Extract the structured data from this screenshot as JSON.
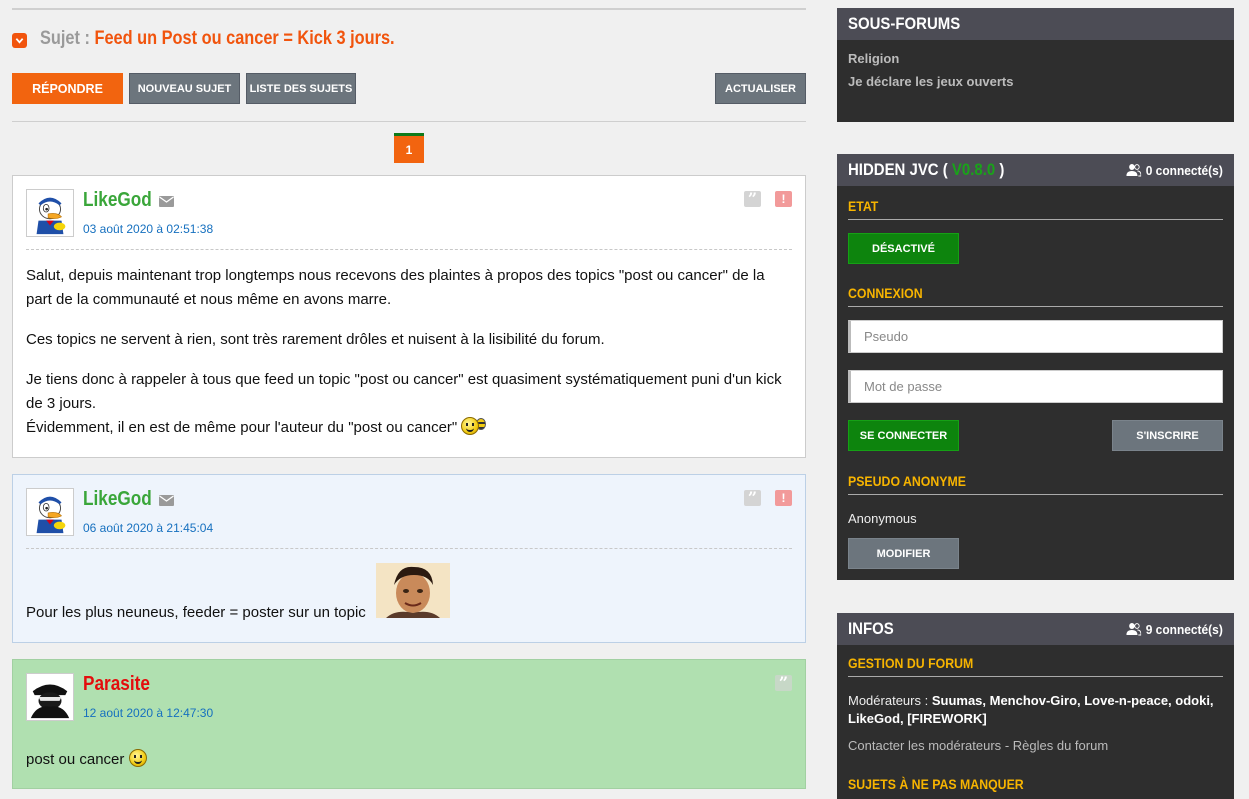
{
  "topic": {
    "prefix": "Sujet :",
    "title": "Feed un Post ou cancer = Kick 3 jours."
  },
  "toolbar": {
    "reply": "RÉPONDRE",
    "new_topic": "NOUVEAU SUJET",
    "topic_list": "LISTE DES SUJETS",
    "refresh": "ACTUALISER"
  },
  "pagination": {
    "current": "1"
  },
  "posts": [
    {
      "author": "LikeGod",
      "date": "03 août 2020 à 02:51:38",
      "paragraphs": [
        "Salut, depuis maintenant trop longtemps nous recevons des plaintes à propos des topics \"post ou cancer\" de la part de la communauté et nous même en avons marre.",
        "Ces topics ne servent à rien, sont très rarement drôles et nuisent à la lisibilité du forum.",
        "Je tiens donc à rappeler à tous que feed un topic \"post ou cancer\" est quasiment systématiquement puni d'un kick de 3 jours.",
        "Évidemment, il en est de même pour l'auteur du \"post ou cancer\""
      ]
    },
    {
      "author": "LikeGod",
      "date": "06 août 2020 à 21:45:04",
      "paragraphs": [
        "Pour les plus neuneus, feeder = poster sur un topic"
      ]
    },
    {
      "author": "Parasite",
      "date": "12 août 2020 à 12:47:30",
      "paragraphs": [
        "post ou cancer"
      ]
    }
  ],
  "sidebar": {
    "subforums": {
      "title": "SOUS-FORUMS",
      "items": [
        "Religion",
        "Je déclare les jeux ouverts"
      ]
    },
    "hidden": {
      "title_prefix": "HIDDEN JVC (",
      "version": "V0.8.0",
      "title_suffix": ")",
      "online": "0 connecté(s)",
      "etat_label": "ETAT",
      "etat_button": "DÉSACTIVÉ",
      "connexion_label": "CONNEXION",
      "pseudo_placeholder": "Pseudo",
      "password_placeholder": "Mot de passe",
      "login_button": "SE CONNECTER",
      "register_button": "S'INSCRIRE",
      "anon_label": "PSEUDO ANONYME",
      "anon_value": "Anonymous",
      "modify_button": "MODIFIER"
    },
    "infos": {
      "title": "INFOS",
      "online": "9 connecté(s)",
      "gestion_label": "GESTION DU FORUM",
      "moderators_prefix": "Modérateurs :",
      "moderators": "Suumas, Menchov-Giro, Love-n-peace, odoki, LikeGod, [FIREWORK]",
      "contact_link": "Contacter les modérateurs",
      "link_sep": "-",
      "rules_link": "Règles du forum",
      "must_see_label": "SUJETS À NE PAS MANQUER"
    }
  },
  "colors": {
    "accent_orange": "#f2640f",
    "author_green": "#3aa63a",
    "author_red": "#e40d0d",
    "date_blue": "#1670bf",
    "section_yellow": "#f7b400",
    "panel_bg": "#2e2e2e",
    "panel_head": "#4c4c55"
  }
}
